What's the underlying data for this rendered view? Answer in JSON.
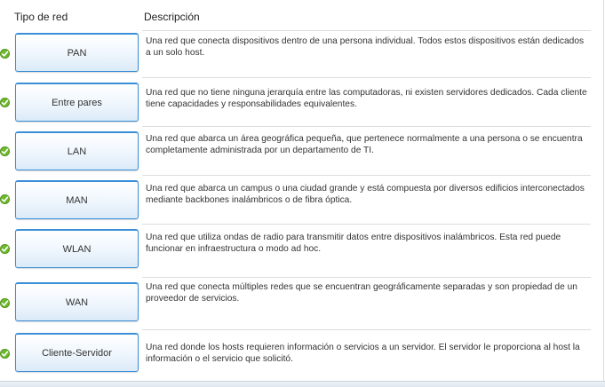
{
  "header": {
    "type_label": "Tipo de red",
    "desc_label": "Descripción"
  },
  "rows": [
    {
      "name": "PAN",
      "description": "Una red que conecta dispositivos dentro de una persona individual. Todos estos dispositivos están dedicados a un solo host.",
      "status_icon": "check-icon",
      "correct": true
    },
    {
      "name": "Entre pares",
      "description": "Una red que no tiene ninguna jerarquía entre las computadoras, ni existen servidores dedicados. Cada cliente tiene capacidades y responsabilidades equivalentes.",
      "status_icon": "check-icon",
      "correct": true
    },
    {
      "name": "LAN",
      "description": "Una red que abarca un área geográfica pequeña, que pertenece normalmente a una persona o se encuentra completamente administrada por un departamento de TI.",
      "status_icon": "check-icon",
      "correct": true
    },
    {
      "name": "MAN",
      "description": "Una red que abarca un campus o una ciudad grande y está compuesta por diversos edificios interconectados mediante backbones inalámbricos o de fibra óptica.",
      "status_icon": "check-icon",
      "correct": true
    },
    {
      "name": "WLAN",
      "description": "Una red que utiliza ondas de radio para transmitir datos entre dispositivos inalámbricos. Esta red puede funcionar en infraestructura o modo ad hoc.",
      "status_icon": "check-icon",
      "correct": true
    },
    {
      "name": "WAN",
      "description": "Una red que conecta múltiples redes que se encuentran geográficamente separadas y son propiedad de un proveedor de servicios.",
      "status_icon": "check-icon",
      "correct": true
    },
    {
      "name": "Cliente-Servidor",
      "description": "Una red donde los hosts requieren información o servicios a un servidor. El servidor le proporciona al host la información o el servicio que solicitó.",
      "status_icon": "check-icon",
      "correct": true
    }
  ],
  "colors": {
    "check": "#6fb82d",
    "card_border": "#3a8fd8",
    "divider": "#dcdcdc"
  }
}
